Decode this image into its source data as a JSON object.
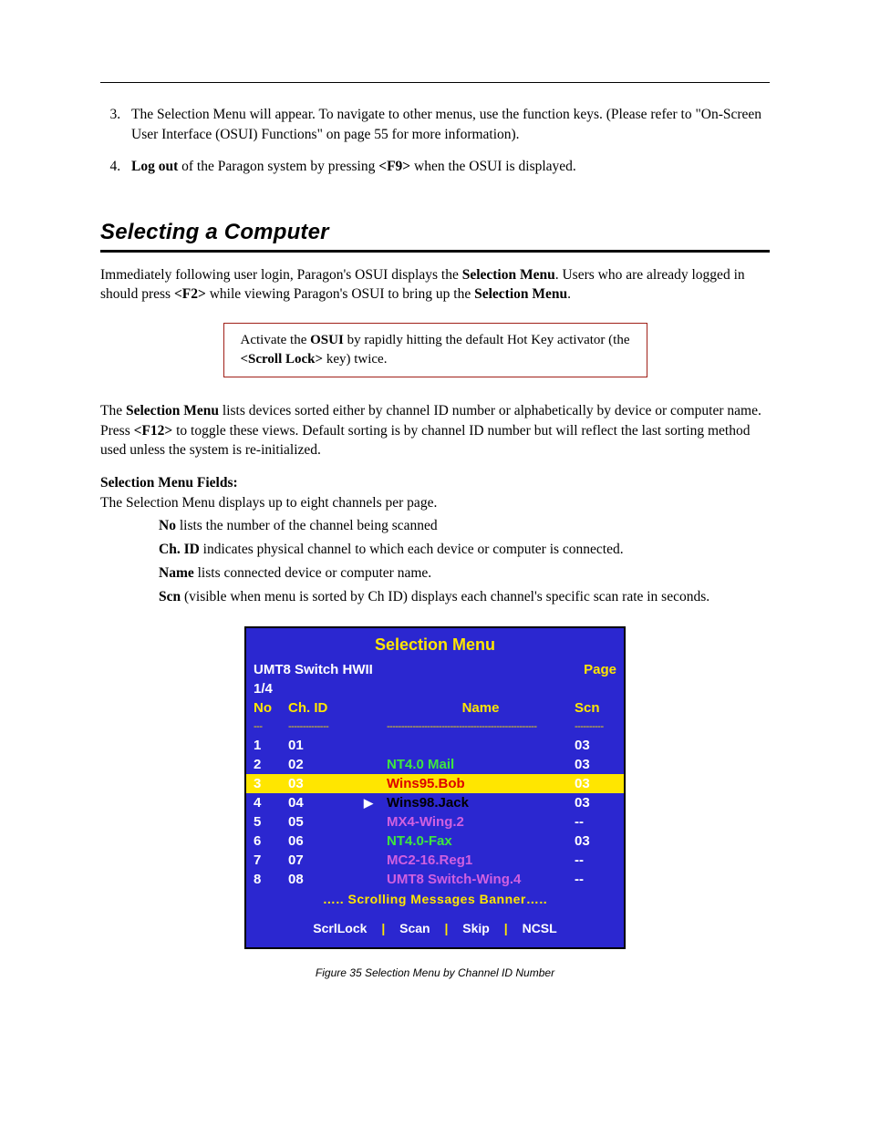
{
  "steps": {
    "item3": {
      "num": "3.",
      "text_a": "The Selection Menu will appear.  To navigate to other menus, use the function keys.  (Please refer to \"On-Screen User Interface (OSUI) Functions\" on page 55 for more information)."
    },
    "item4": {
      "num": "4.",
      "logout_b": "Log out",
      "mid": " of the Paragon system by pressing ",
      "f9_b": "<F9>",
      "tail": " when the OSUI is displayed."
    }
  },
  "section_title": "Selecting a Computer",
  "intro": {
    "a": "Immediately following user login, Paragon's OSUI displays the ",
    "b_sel": "Selection Menu",
    "c": ".  Users who are already logged in should press ",
    "d_f2": "<F2>",
    "e": " while viewing Paragon's OSUI to bring up the ",
    "f_sel": "Selection Menu",
    "g": "."
  },
  "callout": {
    "a": "Activate the ",
    "b_osui": "OSUI",
    "c": " by rapidly hitting the default Hot Key activator (the ",
    "d_sl": "<Scroll Lock>",
    "e": " key) twice."
  },
  "para2": {
    "a": "The ",
    "b_sel": "Selection Menu",
    "c": " lists devices sorted either by channel ID number or alphabetically by device or computer name.  Press ",
    "d_f12": "<F12>",
    "e": " to toggle these views.  Default sorting is by channel ID number but will reflect the last sorting method used unless the system is re-initialized."
  },
  "fields_title": "Selection Menu Fields:",
  "fields_intro": "The Selection Menu displays up to eight channels per page.",
  "fields": {
    "no": {
      "b": "No",
      "t": " lists the number of the channel being scanned"
    },
    "chid": {
      "b": "Ch. ID",
      "t": " indicates physical channel to which each device or computer is connected."
    },
    "name": {
      "b": "Name",
      "t": " lists connected device or computer name."
    },
    "scn": {
      "b": "Scn",
      "t": " (visible when menu is sorted by Ch ID) displays each channel's specific scan rate in seconds."
    }
  },
  "osui": {
    "title": "Selection Menu",
    "switch": "UMT8 Switch HWII",
    "page_label": "Page",
    "page_num": "1/4",
    "hdr": {
      "no": "No",
      "ch": "Ch.  ID",
      "name": "Name",
      "scn": "Scn"
    },
    "sep_no": "---",
    "sep_ch": "--------------",
    "sep_name": "----------------------------------------------------",
    "sep_scn": "----------",
    "rows": [
      {
        "no": "1",
        "ch": "01",
        "arrow": "",
        "name": "",
        "color": "g",
        "scn": "03"
      },
      {
        "no": "2",
        "ch": "02",
        "arrow": "",
        "name": "NT4.0 Mail",
        "color": "g",
        "scn": "03"
      },
      {
        "no": "3",
        "ch": "03",
        "arrow": "",
        "name": "Wins95.Bob",
        "color": "r",
        "scn": "03"
      },
      {
        "no": "4",
        "ch": "04",
        "arrow": "▶",
        "name": "Wins98.Jack",
        "color": "bk",
        "scn": "03"
      },
      {
        "no": "5",
        "ch": "05",
        "arrow": "",
        "name": "MX4-Wing.2",
        "color": "p",
        "scn": "--"
      },
      {
        "no": "6",
        "ch": "06",
        "arrow": "",
        "name": "NT4.0-Fax",
        "color": "g",
        "scn": "03"
      },
      {
        "no": "7",
        "ch": "07",
        "arrow": "",
        "name": "MC2-16.Reg1",
        "color": "p",
        "scn": "--"
      },
      {
        "no": "8",
        "ch": "08",
        "arrow": "",
        "name": "UMT8 Switch-Wing.4",
        "color": "p",
        "scn": "--"
      }
    ],
    "scroll": "….. Scrolling Messages Banner…..",
    "status": {
      "a": "ScrlLock",
      "b": "Scan",
      "c": "Skip",
      "d": "NCSL",
      "sep": "|"
    }
  },
  "figcap": "Figure 35  Selection Menu by Channel ID Number"
}
